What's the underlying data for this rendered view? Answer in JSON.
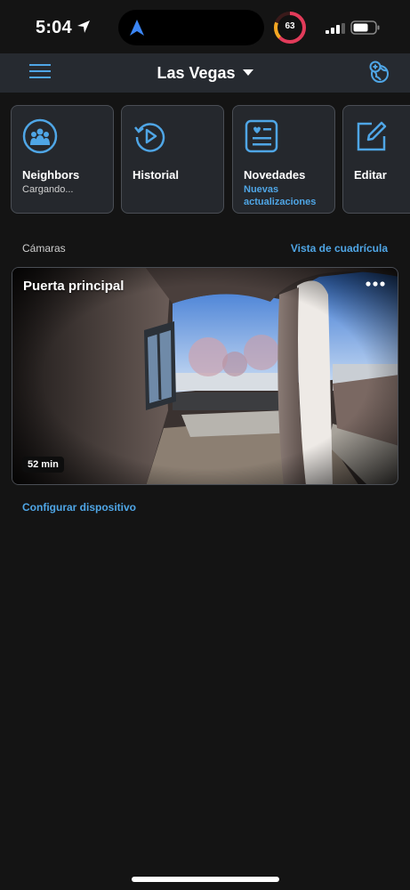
{
  "status_bar": {
    "time": "5:04",
    "activity_value": "63"
  },
  "header": {
    "location": "Las Vegas",
    "icons": {
      "menu": "hamburger-menu-icon",
      "add_location": "add-location-globe-icon"
    }
  },
  "tiles": [
    {
      "label": "Neighbors",
      "sub": "Cargando...",
      "icon": "neighbors-icon"
    },
    {
      "label": "Historial",
      "sub": "",
      "icon": "history-icon"
    },
    {
      "label": "Novedades",
      "sub": "Nuevas actualizaciones",
      "icon": "news-icon"
    },
    {
      "label": "Editar",
      "sub": "",
      "icon": "edit-icon"
    }
  ],
  "cameras_section": {
    "title": "Cámaras",
    "grid_link": "Vista de cuadrícula"
  },
  "camera": {
    "name": "Puerta principal",
    "age": "52 min"
  },
  "configure_link": "Configurar dispositivo",
  "colors": {
    "background": "#141414",
    "header": "#262a30",
    "tile": "#25282d",
    "accent": "#4fa6e6"
  }
}
